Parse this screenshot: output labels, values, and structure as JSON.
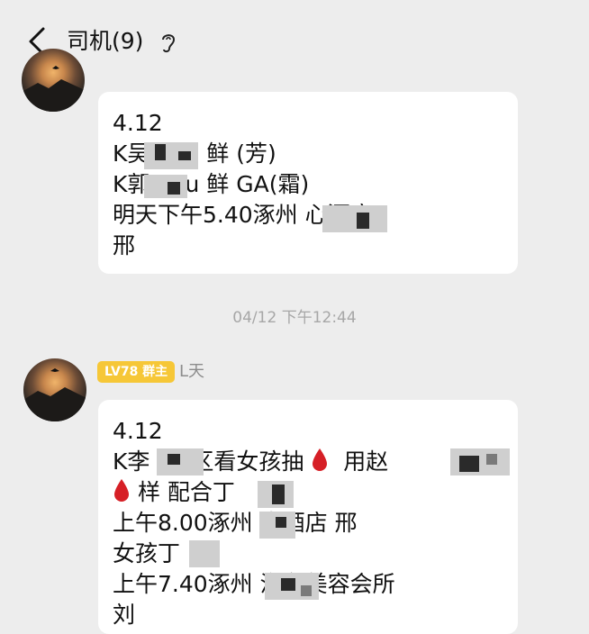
{
  "header": {
    "title": "司机(9)"
  },
  "messages": [
    {
      "lines": [
        "4.12",
        "K吴 opu 鲜 (芳)",
        "K郭 opu 鲜 GA(霜)",
        "明天下午5.40涿州 心酒店",
        "邢"
      ]
    },
    {
      "timestamp": "04/12 下午12:44",
      "badge": "LV78 群主",
      "sender": "L天",
      "lines": [
        "4.12",
        "K李 来s区看女孩抽",
        "用赵",
        "样 配合丁",
        "上午8.00涿州 水酒店 邢",
        "女孩丁",
        "上午7.40涿州 汽车美容会所",
        "刘"
      ]
    }
  ],
  "colors": {
    "background": "#ededed",
    "bubble": "#ffffff",
    "badge": "#f6c737",
    "drop": "#d61f26"
  },
  "icons": [
    "back-arrow-icon",
    "ear-icon",
    "blood-drop-icon"
  ]
}
